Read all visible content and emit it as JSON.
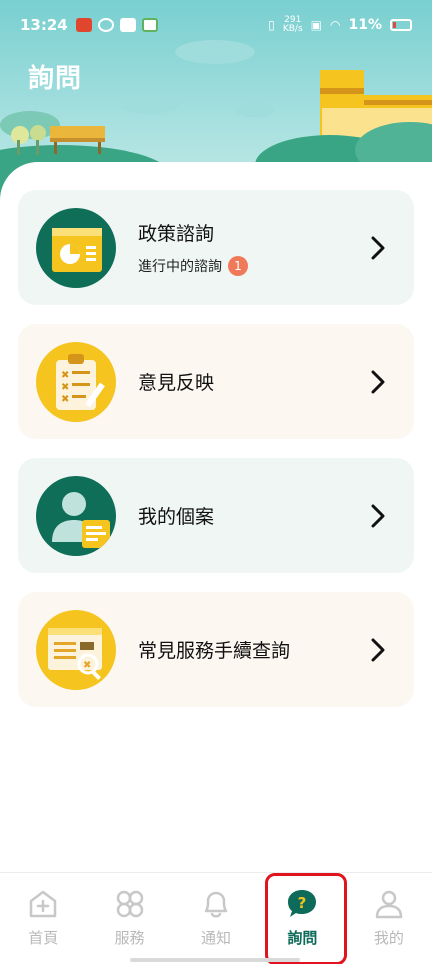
{
  "status_bar": {
    "time": "13:24",
    "net_speed_value": "291",
    "net_speed_unit": "KB/s",
    "battery": "11%"
  },
  "page": {
    "title": "詢問"
  },
  "cards": [
    {
      "title": "政策諮詢",
      "subtitle": "進行中的諮詢",
      "badge": "1",
      "icon": "policy-chart-icon"
    },
    {
      "title": "意見反映",
      "icon": "clipboard-icon"
    },
    {
      "title": "我的個案",
      "icon": "user-case-icon"
    },
    {
      "title": "常見服務手續查詢",
      "icon": "service-lookup-icon"
    }
  ],
  "nav": [
    {
      "label": "首頁",
      "icon": "home-icon"
    },
    {
      "label": "服務",
      "icon": "services-icon"
    },
    {
      "label": "通知",
      "icon": "bell-icon"
    },
    {
      "label": "詢問",
      "icon": "question-icon"
    },
    {
      "label": "我的",
      "icon": "profile-icon"
    }
  ],
  "colors": {
    "brand_green": "#0e6b5a",
    "accent_yellow": "#f5c41e",
    "badge": "#f0795a",
    "header_teal": "#79cfd0",
    "highlight": "#e0141e"
  }
}
